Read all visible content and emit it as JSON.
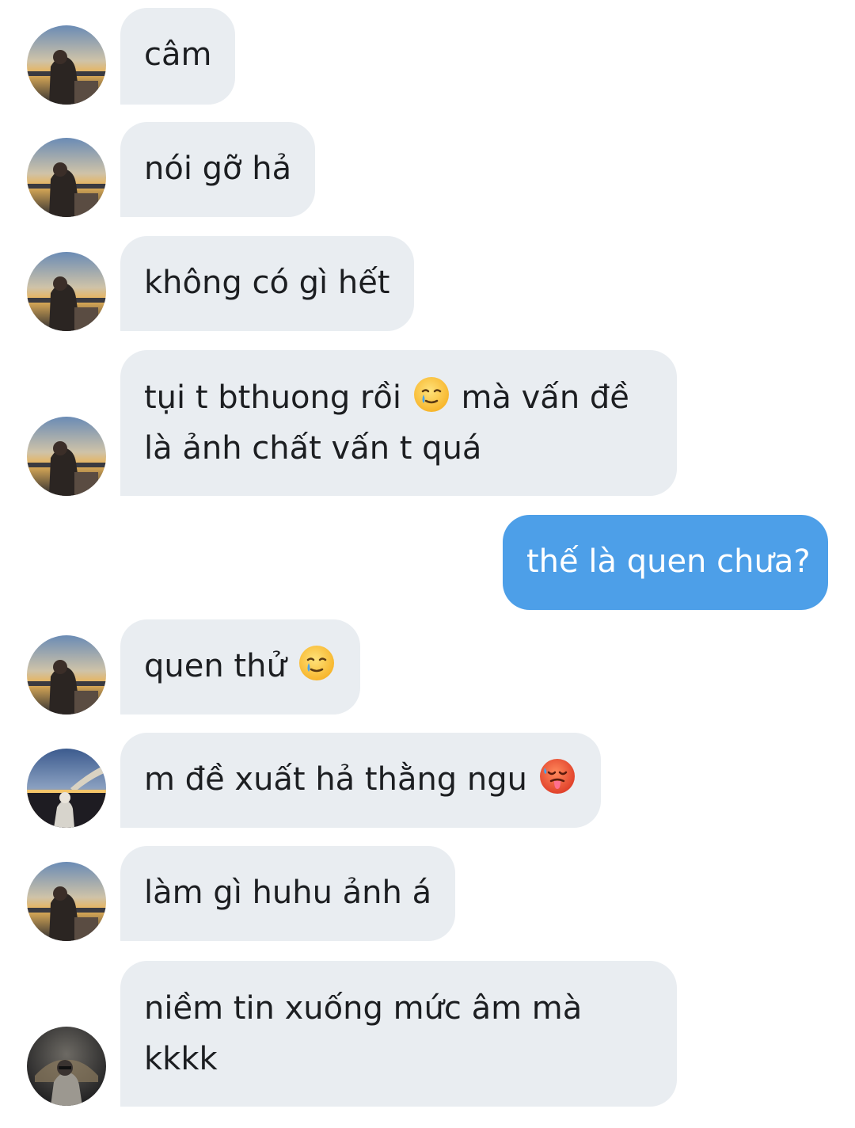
{
  "messages": [
    {
      "text": "câm"
    },
    {
      "text": "nói gỡ hả"
    },
    {
      "text": "không có gì hết"
    },
    {
      "text_line1a": "tụi t bthuong rồi",
      "emoji1": "crying-smile-emoji",
      "text_line1b": "mà vấn đề",
      "text_line2": "là ảnh chất vấn t quá"
    },
    {
      "text": "thế là quen chưa?"
    },
    {
      "text": "quen thử",
      "emoji": "crying-smile-emoji"
    },
    {
      "text": "m đề xuất hả thằng ngu",
      "emoji": "hot-face-emoji"
    },
    {
      "text": "làm gì huhu ảnh á"
    },
    {
      "text_line1": "niềm tin xuống mức âm mà",
      "text_line2": "kkkk"
    }
  ],
  "colors": {
    "incoming_bubble": "#e9edf1",
    "outgoing_bubble": "#4d9fe8",
    "incoming_text": "#1c1e21",
    "outgoing_text": "#ffffff"
  }
}
